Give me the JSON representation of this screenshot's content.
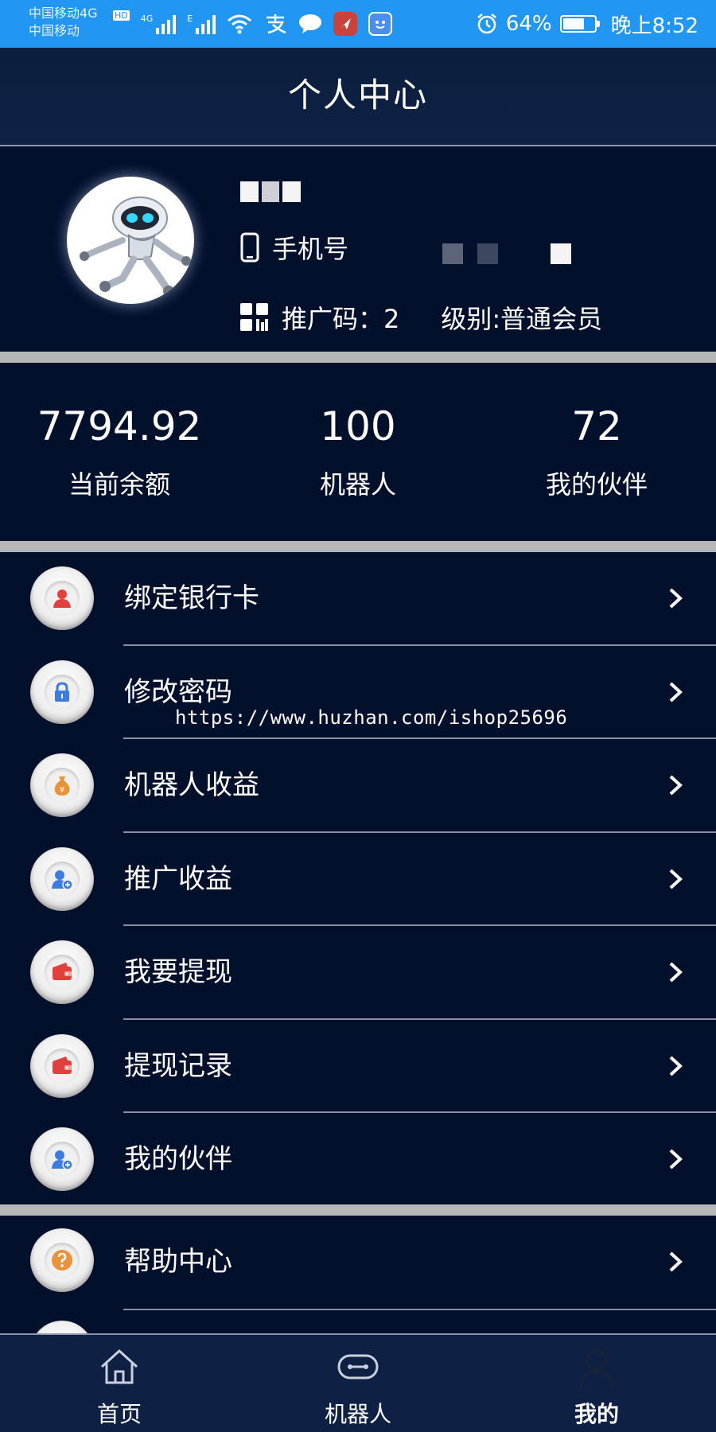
{
  "status_bar": {
    "carrier_line1": "中国移动4G",
    "carrier_line2": "中国移动",
    "hd_badge": "HD",
    "net_badge": "4G",
    "edge_badge": "E",
    "battery_percent": "64%",
    "battery_level": 0.64,
    "time": "晚上8:52"
  },
  "header": {
    "title": "个人中心"
  },
  "profile": {
    "phone_label": "手机号",
    "promo_label": "推广码：2",
    "level_label": "级别:普通会员"
  },
  "stats": [
    {
      "value": "7794.92",
      "label": "当前余额"
    },
    {
      "value": "100",
      "label": "机器人"
    },
    {
      "value": "72",
      "label": "我的伙伴"
    }
  ],
  "menu": [
    {
      "label": "绑定银行卡",
      "icon": "user-icon",
      "color": "#e0413d"
    },
    {
      "label": "修改密码",
      "icon": "lock-icon",
      "color": "#3c7be0"
    },
    {
      "label": "机器人收益",
      "icon": "money-bag-icon",
      "color": "#e8923a"
    },
    {
      "label": "推广收益",
      "icon": "user-add-icon",
      "color": "#3c7be0"
    },
    {
      "label": "我要提现",
      "icon": "wallet-icon",
      "color": "#e0413d"
    },
    {
      "label": "提现记录",
      "icon": "wallet-icon",
      "color": "#e0413d"
    },
    {
      "label": "我的伙伴",
      "icon": "user-add-icon",
      "color": "#3c7be0"
    }
  ],
  "menu2": [
    {
      "label": "帮助中心",
      "icon": "help-icon",
      "color": "#e8923a"
    }
  ],
  "watermark": "https://www.huzhan.com/ishop25696",
  "bottom_nav": [
    {
      "label": "首页",
      "icon": "home-icon"
    },
    {
      "label": "机器人",
      "icon": "robot-icon"
    },
    {
      "label": "我的",
      "icon": "person-icon",
      "active": true
    }
  ]
}
